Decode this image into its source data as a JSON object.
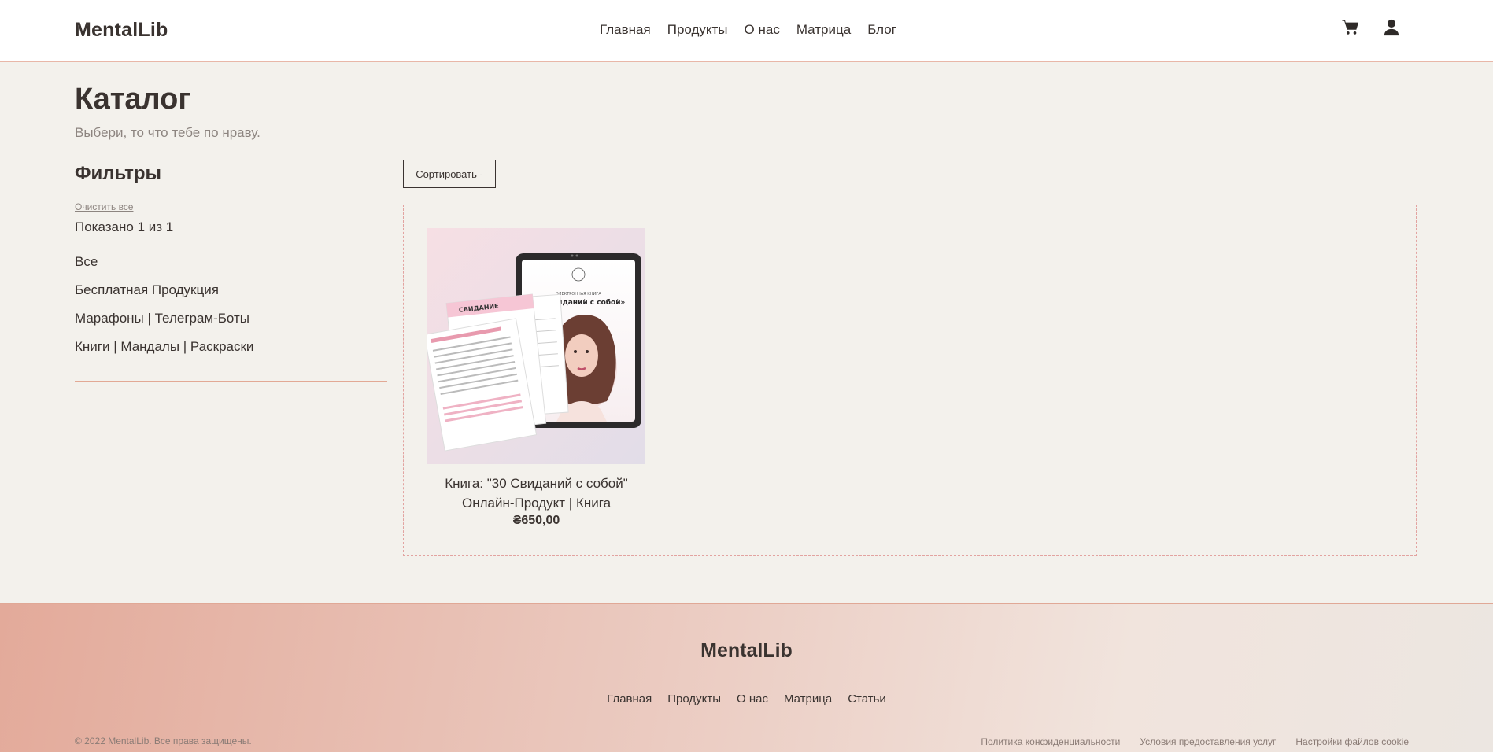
{
  "header": {
    "logo": "MentalLib",
    "nav": [
      "Главная",
      "Продукты",
      "О нас",
      "Матрица",
      "Блог"
    ],
    "icons": [
      "cart-icon",
      "user-icon"
    ]
  },
  "catalog": {
    "title": "Каталог",
    "subtitle": "Выбери, то что тебе по нраву."
  },
  "filters": {
    "title": "Фильтры",
    "clear_all": "Очистить все",
    "shown": "Показано 1 из 1",
    "categories": [
      "Все",
      "Бесплатная Продукция",
      "Марафоны | Телеграм-Боты",
      "Книги | Мандалы | Раскраски"
    ]
  },
  "sort": {
    "label": "Сортировать -"
  },
  "products": [
    {
      "title_line1": "Книга: \"30 Свиданий с собой\"",
      "title_line2": "Онлайн-Продукт | Книга",
      "price": "₴650,00",
      "image": {
        "tablet_heading": "«30 свиданий с собой»",
        "tablet_small": "ЭЛЕКТРОННАЯ КНИГА",
        "paper_heading": "СВИДАНИЕ"
      }
    }
  ],
  "footer": {
    "logo": "MentalLib",
    "nav": [
      "Главная",
      "Продукты",
      "О нас",
      "Матрица",
      "Статьи"
    ],
    "copyright": "© 2022 MentalLib. Все права защищены.",
    "links": [
      "Политика конфиденциальности",
      "Условия предоставления услуг",
      "Настройки файлов cookie"
    ]
  },
  "colors": {
    "page_bg": "#f3f1ec",
    "text": "#3a3330",
    "accent_line": "#e2a995",
    "footer_gradient_start": "#e3aa9a"
  }
}
